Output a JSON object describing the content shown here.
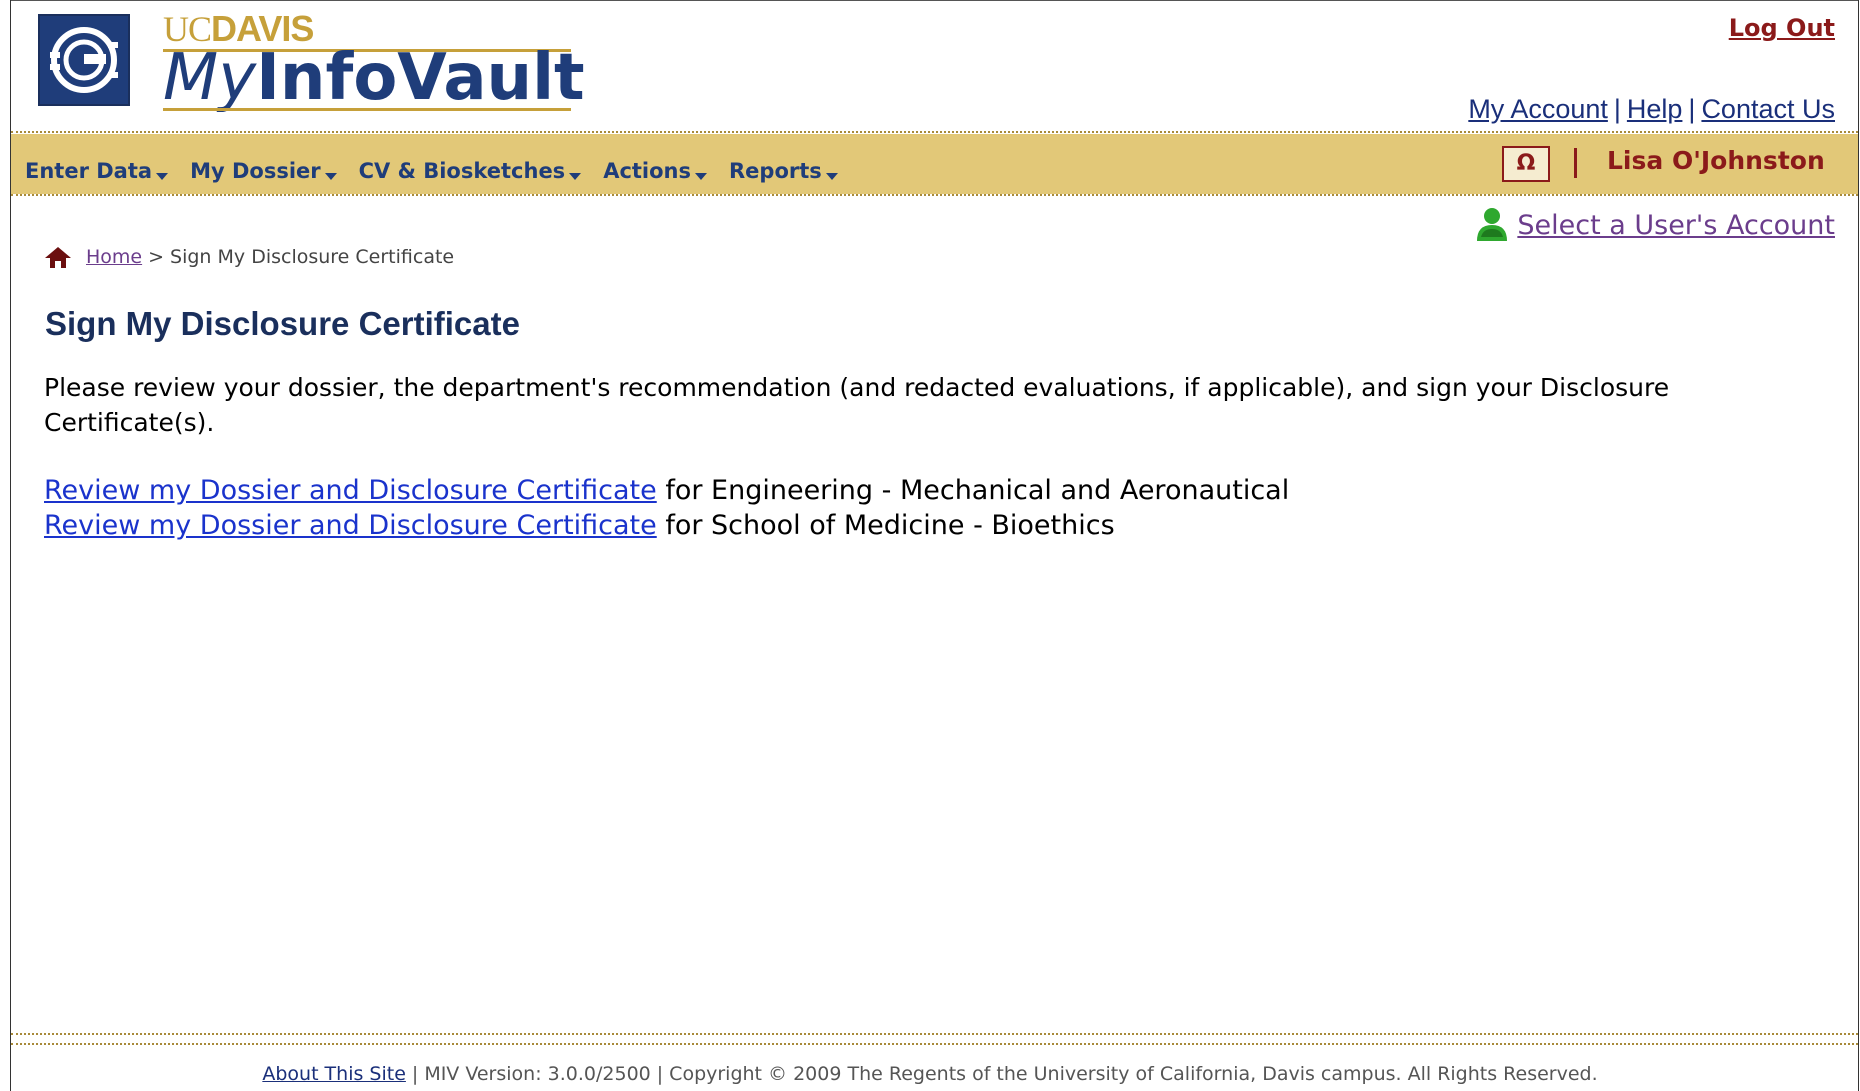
{
  "header": {
    "logo_small": "UCDAVIS",
    "logo_small_prefix": "UC",
    "logo_small_suffix": "DAVIS",
    "app_name_prefix": "My",
    "app_name_suffix": "InfoVault",
    "logout_label": "Log Out",
    "toplinks": {
      "my_account": "My Account",
      "help": "Help",
      "contact_us": "Contact Us",
      "separator": "|"
    }
  },
  "nav": {
    "items": [
      {
        "label": "Enter Data"
      },
      {
        "label": "My Dossier"
      },
      {
        "label": "CV & Biosketches"
      },
      {
        "label": "Actions"
      },
      {
        "label": "Reports"
      }
    ],
    "omega_label": "Ω",
    "user_name": "Lisa O'Johnston"
  },
  "select_user": {
    "label": "Select a User's Account"
  },
  "breadcrumb": {
    "home": "Home",
    "separator": ">",
    "current": "Sign My Disclosure Certificate"
  },
  "main": {
    "title": "Sign My Disclosure Certificate",
    "intro": "Please review your dossier, the department's recommendation (and redacted evaluations, if applicable), and sign your Disclosure Certificate(s).",
    "review_links": [
      {
        "link_text": "Review my Dossier and Disclosure Certificate",
        "suffix": " for Engineering - Mechanical and Aeronautical"
      },
      {
        "link_text": "Review my Dossier and Disclosure Certificate",
        "suffix": " for School of Medicine - Bioethics"
      }
    ]
  },
  "footer": {
    "about": "About This Site",
    "separator": "|",
    "version": "MIV Version: 3.0.0/2500",
    "copyright": "Copyright © 2009 The Regents of the University of California, Davis campus. All Rights Reserved."
  },
  "colors": {
    "navy": "#1f3d7a",
    "gold": "#c6a03a",
    "nav_bg": "#e2c878",
    "maroon": "#8b1a1a",
    "link_blue": "#1a33cc",
    "visited_purple": "#6b3d8c"
  }
}
